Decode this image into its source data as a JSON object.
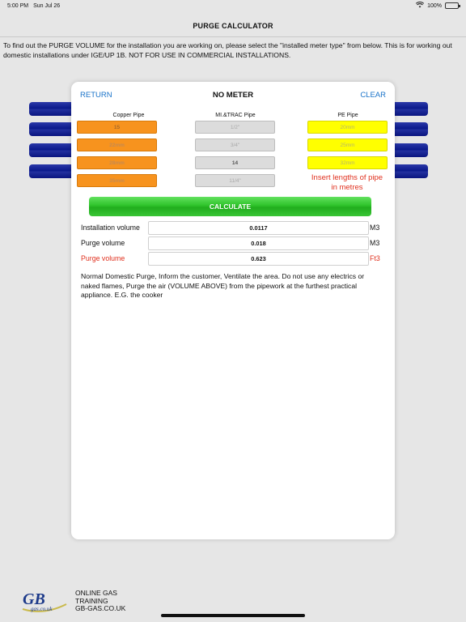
{
  "status_bar": {
    "time": "5:00 PM",
    "date": "Sun Jul 26",
    "battery": "100%"
  },
  "nav": {
    "title": "PURGE CALCULATOR"
  },
  "intro_text": "To find out the PURGE VOLUME for the installation you are working on, please select the \"installed meter type\" from below. This is for working out domestic installations under IGE/UP 1B. NOT FOR USE IN COMMERCIAL INSTALLATIONS.",
  "modal": {
    "return_label": "RETURN",
    "title": "NO METER",
    "clear_label": "CLEAR",
    "columns": {
      "copper": {
        "heading": "Copper Pipe",
        "fields": [
          {
            "placeholder": "15",
            "value": "15"
          },
          {
            "placeholder": "22mm",
            "value": ""
          },
          {
            "placeholder": "28mm",
            "value": ""
          },
          {
            "placeholder": "35mm",
            "value": ""
          }
        ]
      },
      "mi_trac": {
        "heading": "MI.&TRAC Pipe",
        "fields": [
          {
            "placeholder": "1/2\"",
            "value": ""
          },
          {
            "placeholder": "3/4\"",
            "value": ""
          },
          {
            "placeholder": "1\"",
            "value": "14"
          },
          {
            "placeholder": "11/4\"",
            "value": ""
          }
        ]
      },
      "pe": {
        "heading": "PE Pipe",
        "fields": [
          {
            "placeholder": "20mm",
            "value": ""
          },
          {
            "placeholder": "25mm",
            "value": ""
          },
          {
            "placeholder": "32mm",
            "value": ""
          }
        ]
      }
    },
    "insert_note": "Insert lengths of pipe in metres",
    "calculate_label": "CALCULATE",
    "results": [
      {
        "label": "Installation volume",
        "value": "0.0117",
        "unit": "M3"
      },
      {
        "label": "Purge volume",
        "value": "0.018",
        "unit": "M3"
      },
      {
        "label": "Purge volume",
        "value": "0.623",
        "unit": "Ft3"
      }
    ],
    "advice": "Normal Domestic Purge, Inform the customer, Ventilate the area. Do not use any electrics or naked flames, Purge the air (VOLUME ABOVE) from the pipework at the furthest practical appliance. E.G. the cooker"
  },
  "footer": {
    "logo_text": "GB",
    "logo_subtext": "gas.co.uk",
    "line1": "ONLINE GAS",
    "line2": "TRAINING",
    "line3": "GB-GAS.CO.UK"
  },
  "colors": {
    "copper": "#f7931e",
    "mi_trac": "#dcdcdc",
    "pe": "#ffff00",
    "calculate": "#2fc32b",
    "link": "#1a73c9",
    "warning": "#e0301e"
  }
}
